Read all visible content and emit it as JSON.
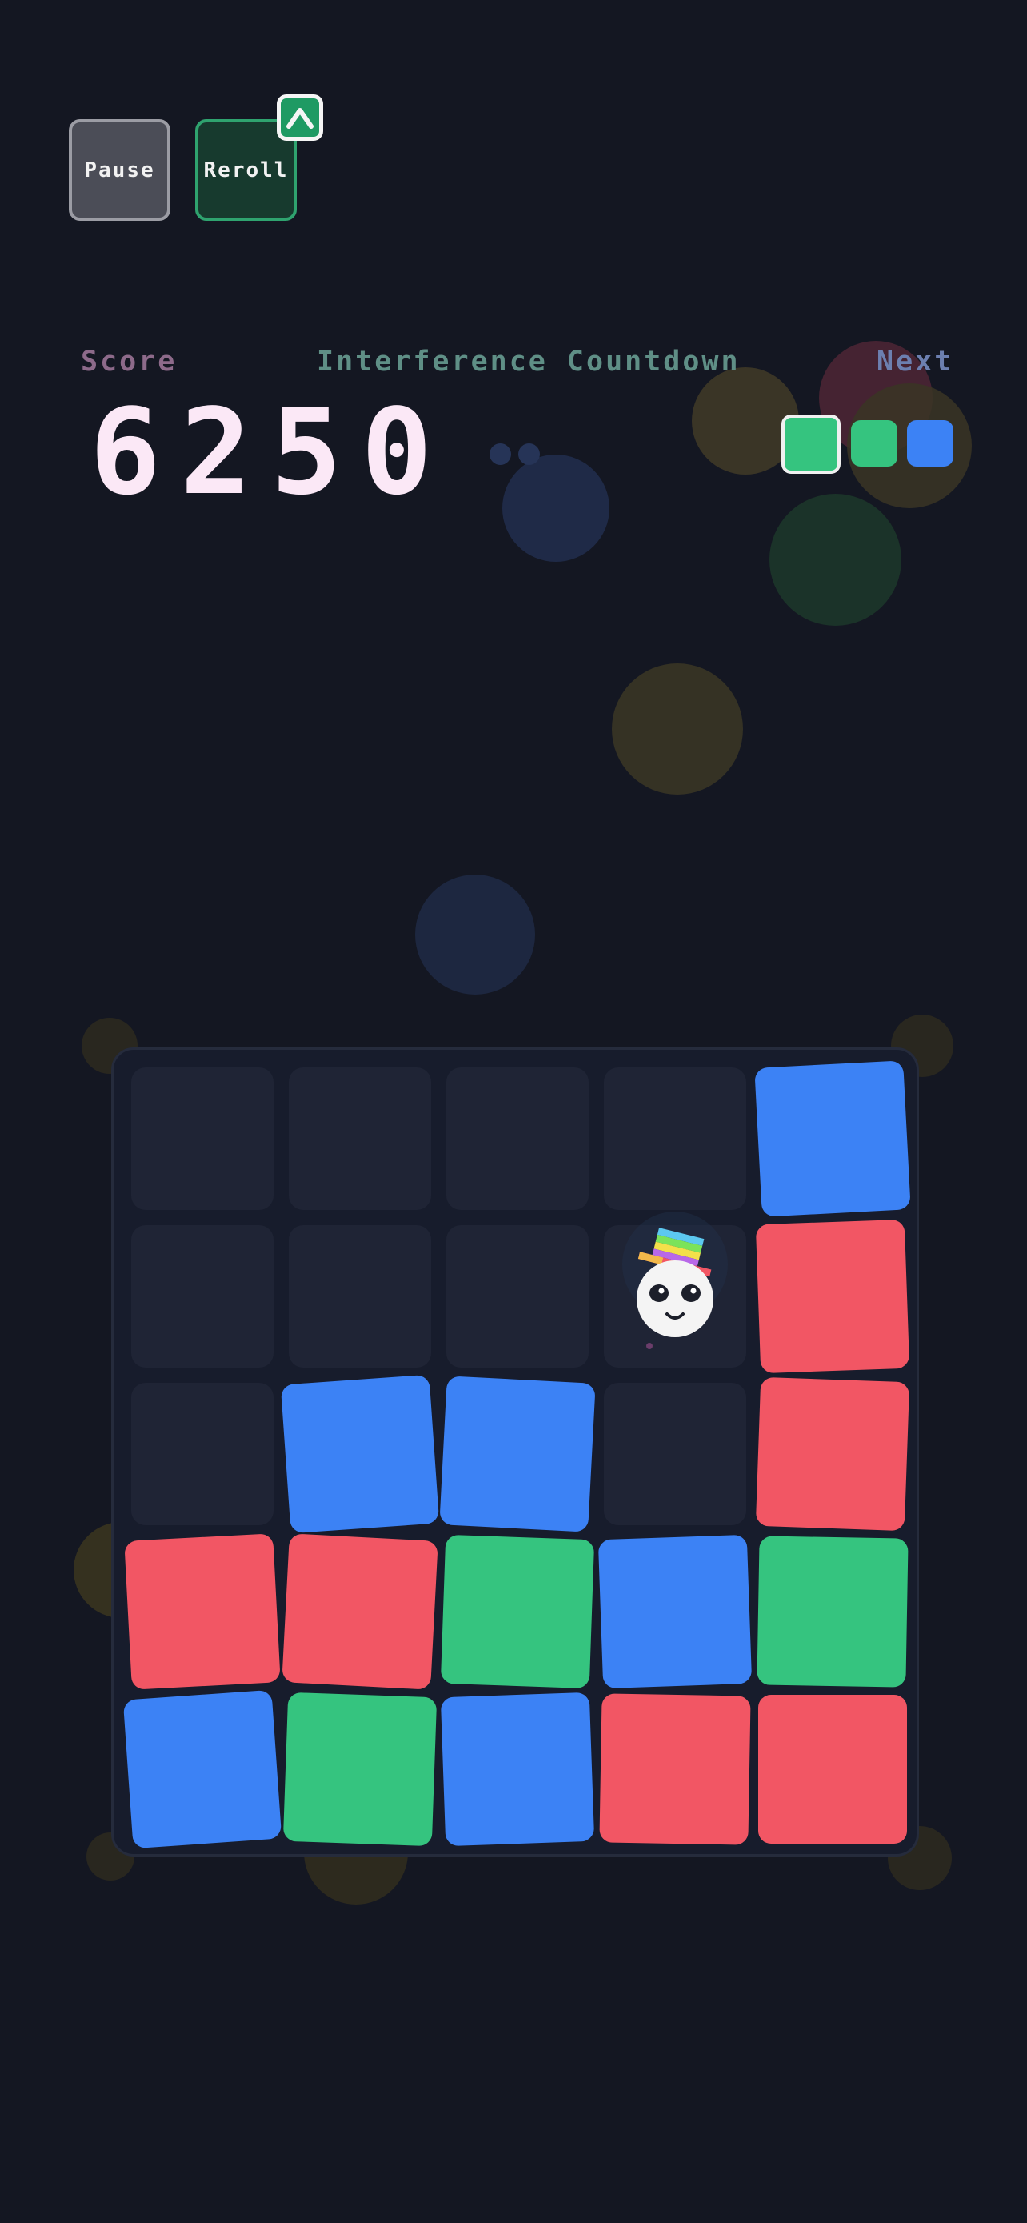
{
  "controls": {
    "pause_label": "Pause",
    "reroll_label": "Reroll",
    "reroll_badge_icon": "chevron-up-icon"
  },
  "hud": {
    "score_label": "Score",
    "score_value": "6250",
    "countdown_label": "Interference Countdown",
    "countdown_remaining_dots": 2,
    "next_label": "Next",
    "next_queue": [
      "green",
      "green",
      "blue"
    ]
  },
  "colors": {
    "red": "#f25664",
    "blue": "#3c82f5",
    "green": "#35c47f",
    "empty": "#1f2435",
    "background": "#141722"
  },
  "board": {
    "rows": 5,
    "cols": 5,
    "player": {
      "row": 1,
      "col": 3,
      "name": "panda-with-rainbow-hat"
    },
    "cells": [
      [
        "empty",
        "empty",
        "empty",
        "empty",
        "blue"
      ],
      [
        "empty",
        "empty",
        "empty",
        "empty",
        "red"
      ],
      [
        "empty",
        "blue",
        "blue",
        "empty",
        "red"
      ],
      [
        "red",
        "red",
        "green",
        "blue",
        "green"
      ],
      [
        "blue",
        "green",
        "blue",
        "red",
        "red"
      ]
    ]
  }
}
